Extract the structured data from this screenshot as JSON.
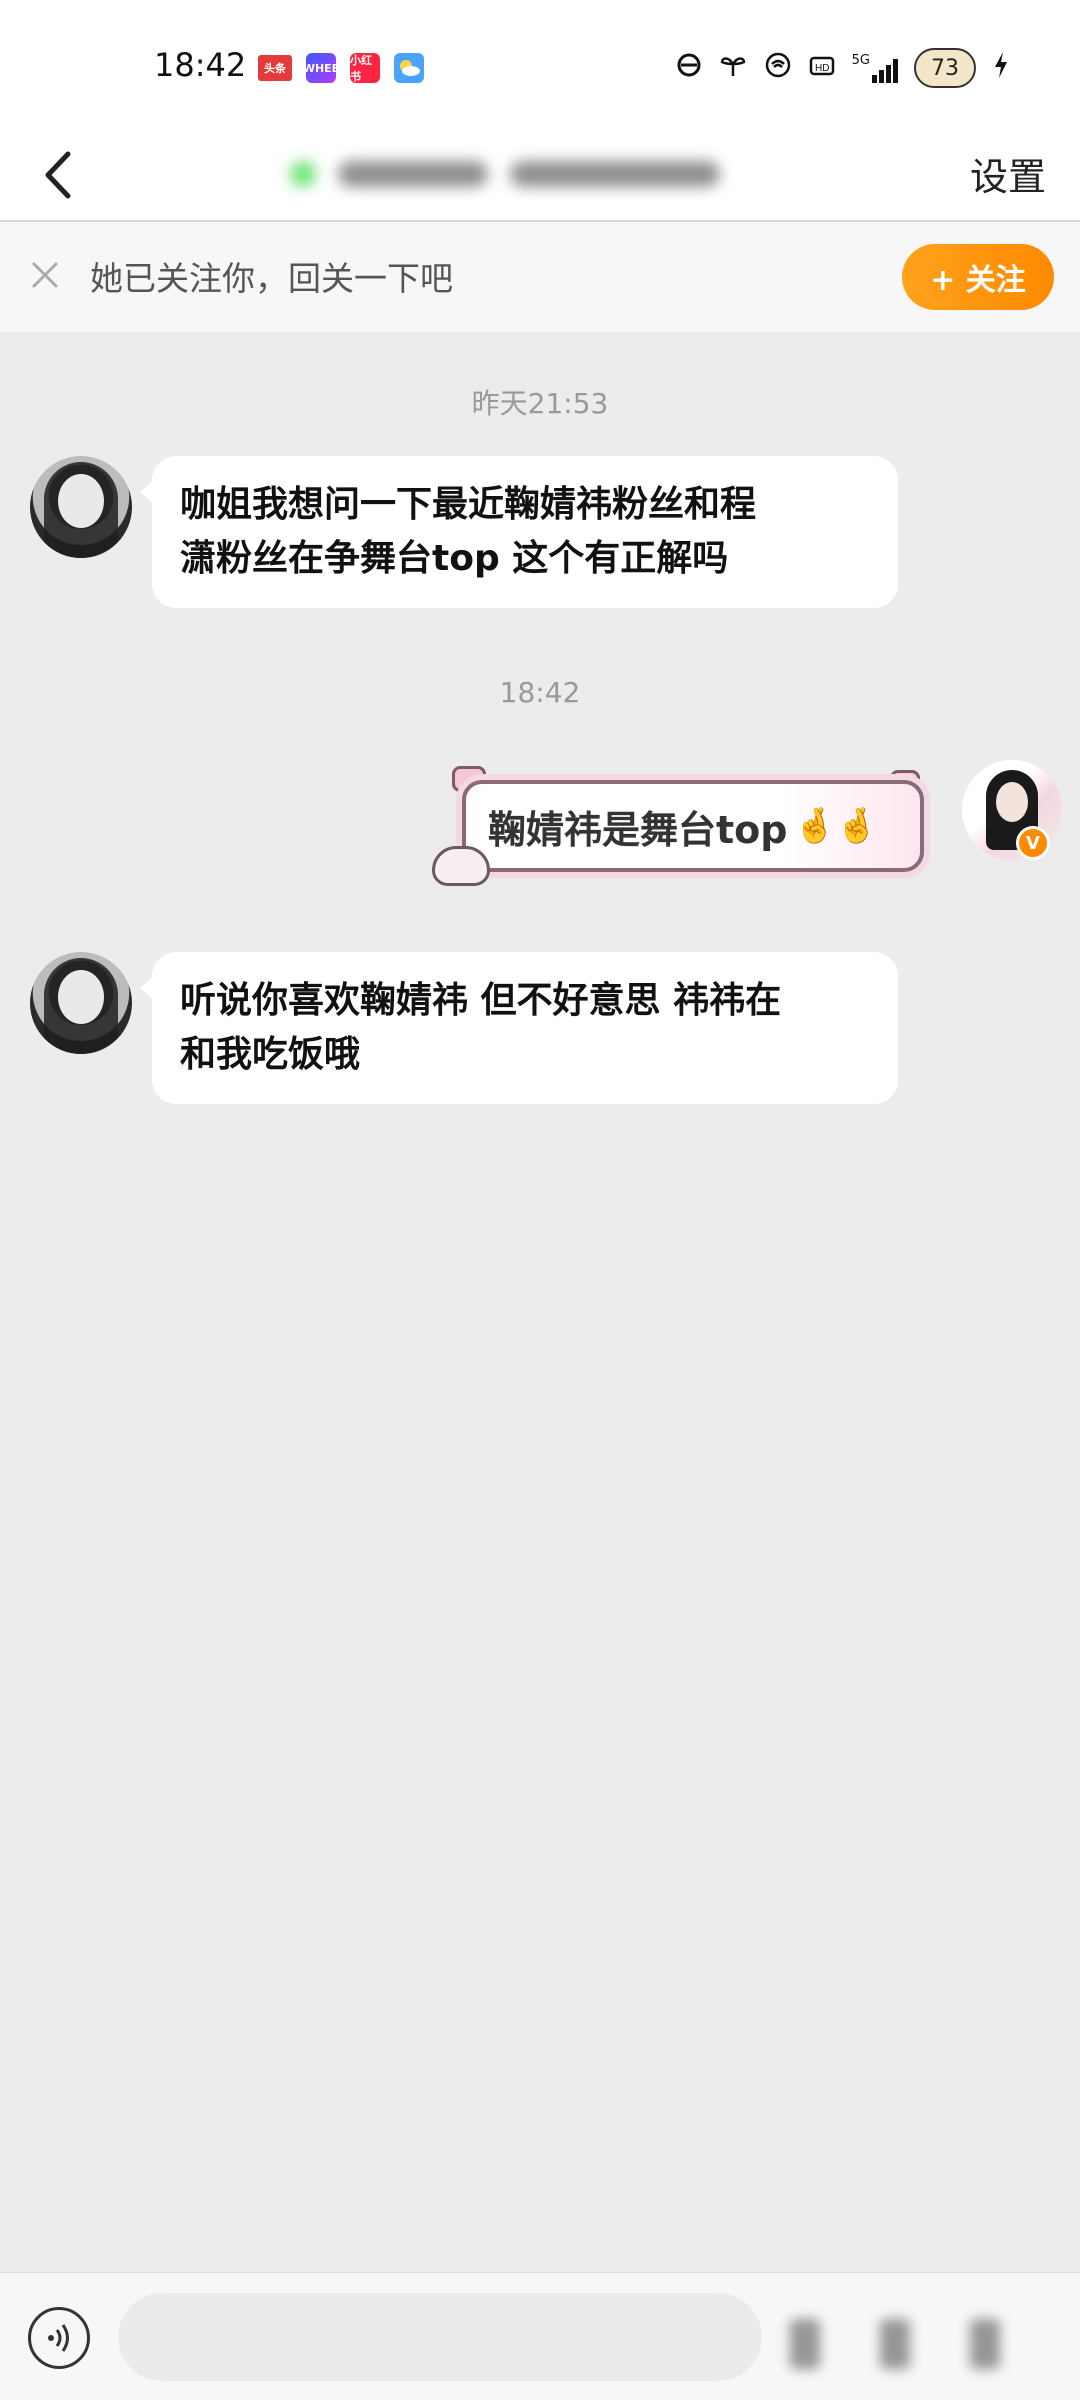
{
  "status_bar": {
    "time": "18:42",
    "notification_icons": [
      "toutiao-app-icon",
      "whee-app-icon",
      "xiaohongshu-app-icon",
      "weather-app-icon"
    ],
    "notif_labels": [
      "头条",
      "WHEE",
      "小红书",
      ""
    ],
    "network": "5G",
    "battery": "73"
  },
  "nav": {
    "back_icon": "chevron-left-icon",
    "settings_label": "设置"
  },
  "follow_banner": {
    "text": "她已关注你，回关一下吧",
    "button_label": "+ 关注",
    "accent_color": "#ff8a00"
  },
  "messages": [
    {
      "type": "timestamp",
      "text": "昨天21:53"
    },
    {
      "type": "incoming",
      "line1": "咖姐我想问一下最近鞠婧祎粉丝和程",
      "line2": "潇粉丝在争舞台top 这个有正解吗"
    },
    {
      "type": "timestamp",
      "text": "18:42"
    },
    {
      "type": "outgoing",
      "text": "鞠婧祎是舞台top",
      "emoji": "🤞🤞"
    },
    {
      "type": "incoming",
      "line1": "听说你喜欢鞠婧祎 但不好意思 祎祎在",
      "line2": "和我吃饭哦"
    }
  ],
  "input_bar": {
    "value": "",
    "placeholder": ""
  }
}
